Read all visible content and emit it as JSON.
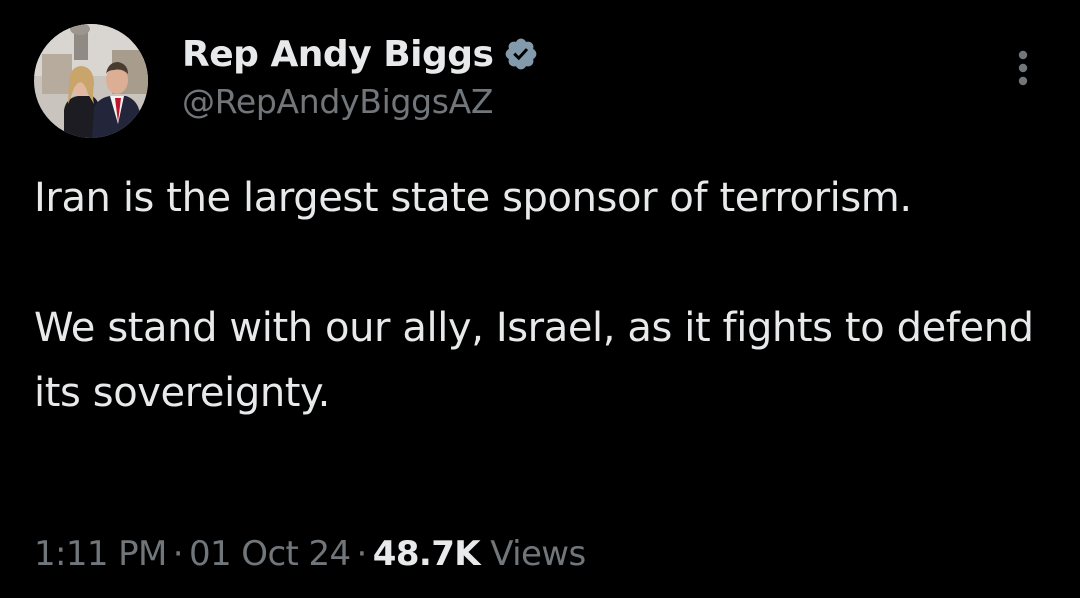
{
  "author": {
    "display_name": "Rep Andy Biggs",
    "handle": "@RepAndyBiggsAZ",
    "verified_icon": "verified-badge-icon",
    "avatar": "profile-photo"
  },
  "tweet": {
    "paragraphs": [
      "Iran is the largest state sponsor of terrorism.",
      "We stand with our ally, Israel, as it fights to defend its sovereignty."
    ]
  },
  "meta": {
    "time": "1:11 PM",
    "date": "01 Oct 24",
    "views_count": "48.7K",
    "views_label": "Views",
    "separator": "·"
  },
  "menu": {
    "icon": "more-options-icon"
  },
  "colors": {
    "background": "#000000",
    "primary_text": "#e7e9ea",
    "secondary_text": "#71767b",
    "verified": "#829aab"
  }
}
